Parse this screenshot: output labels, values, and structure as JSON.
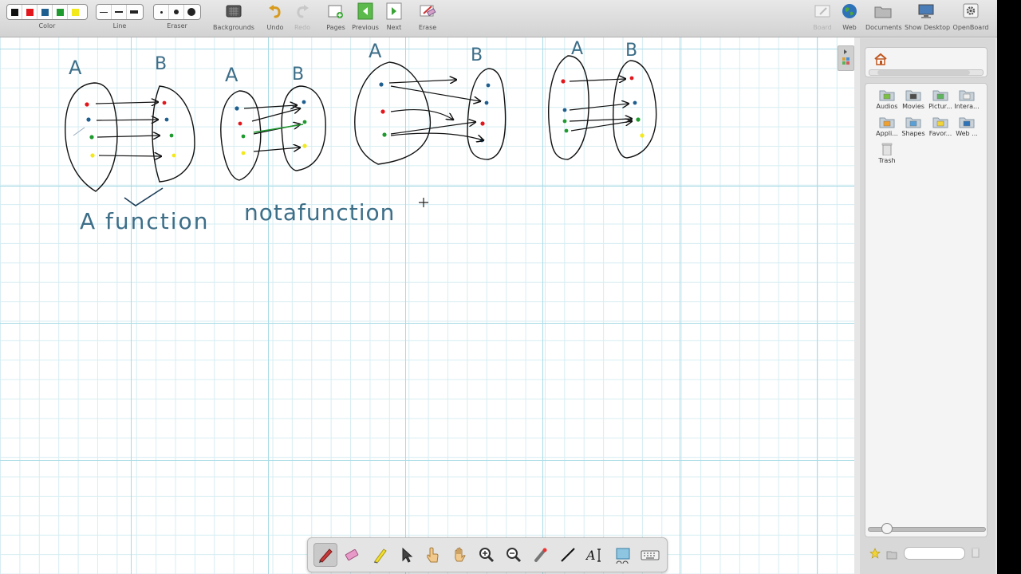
{
  "toolbar": {
    "color_label": "Color",
    "line_label": "Line",
    "eraser_label": "Eraser",
    "colors": [
      "#111111",
      "#e3161b",
      "#1f5f8f",
      "#1f9a2e",
      "#f3e91a"
    ],
    "buttons": {
      "backgrounds": "Backgrounds",
      "undo": "Undo",
      "redo": "Redo",
      "pages": "Pages",
      "previous": "Previous",
      "next": "Next",
      "erase": "Erase"
    },
    "right_buttons": {
      "board": "Board",
      "web": "Web",
      "documents": "Documents",
      "show_desktop": "Show Desktop",
      "openboard": "OpenBoard"
    }
  },
  "board": {
    "diagrams": [
      {
        "left_label": "A",
        "right_label": "B"
      },
      {
        "left_label": "A",
        "right_label": "B"
      },
      {
        "left_label": "A",
        "right_label": "B"
      },
      {
        "left_label": "A",
        "right_label": "B"
      }
    ],
    "caption_function": "A function",
    "caption_not_function": "notafunction"
  },
  "library": {
    "items": [
      {
        "label": "Audios",
        "icon": "audio-folder-icon"
      },
      {
        "label": "Movies",
        "icon": "movie-folder-icon"
      },
      {
        "label": "Pictur...",
        "icon": "pictures-folder-icon"
      },
      {
        "label": "Intera...",
        "icon": "interactive-folder-icon"
      },
      {
        "label": "Appli...",
        "icon": "applications-folder-icon"
      },
      {
        "label": "Shapes",
        "icon": "shapes-folder-icon"
      },
      {
        "label": "Favor...",
        "icon": "favorites-folder-icon"
      },
      {
        "label": "Web ...",
        "icon": "web-folder-icon"
      },
      {
        "label": "Trash",
        "icon": "trash-icon"
      }
    ]
  },
  "bottom_tools": [
    "pen-icon",
    "eraser-icon",
    "highlighter-icon",
    "select-icon",
    "interact-icon",
    "hand-icon",
    "zoom-in-icon",
    "zoom-out-icon",
    "laser-pointer-icon",
    "line-icon",
    "text-icon",
    "capture-icon",
    "keyboard-icon"
  ]
}
